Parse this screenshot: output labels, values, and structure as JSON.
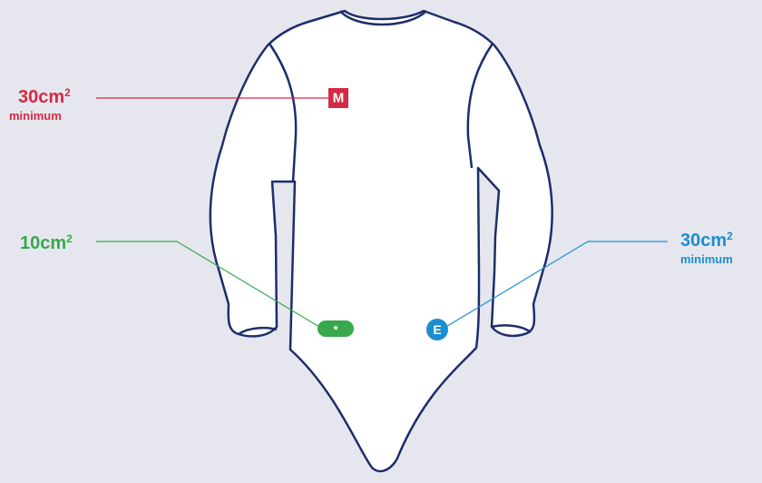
{
  "colors": {
    "background": "#e6e7ee",
    "outline": "#1e2d6b",
    "garment_fill": "#ffffff",
    "manufacturer": "#d62a44",
    "flag": "#38a84c",
    "event": "#1b8ed0"
  },
  "labels": {
    "manufacturer": {
      "size": "30cm",
      "exp": "2",
      "note": "minimum"
    },
    "flag": {
      "size": "10cm",
      "exp": "2"
    },
    "event": {
      "size": "30cm",
      "exp": "2",
      "note": "minimum"
    }
  },
  "badges": {
    "manufacturer": "M",
    "flag": "*",
    "event": "E"
  }
}
